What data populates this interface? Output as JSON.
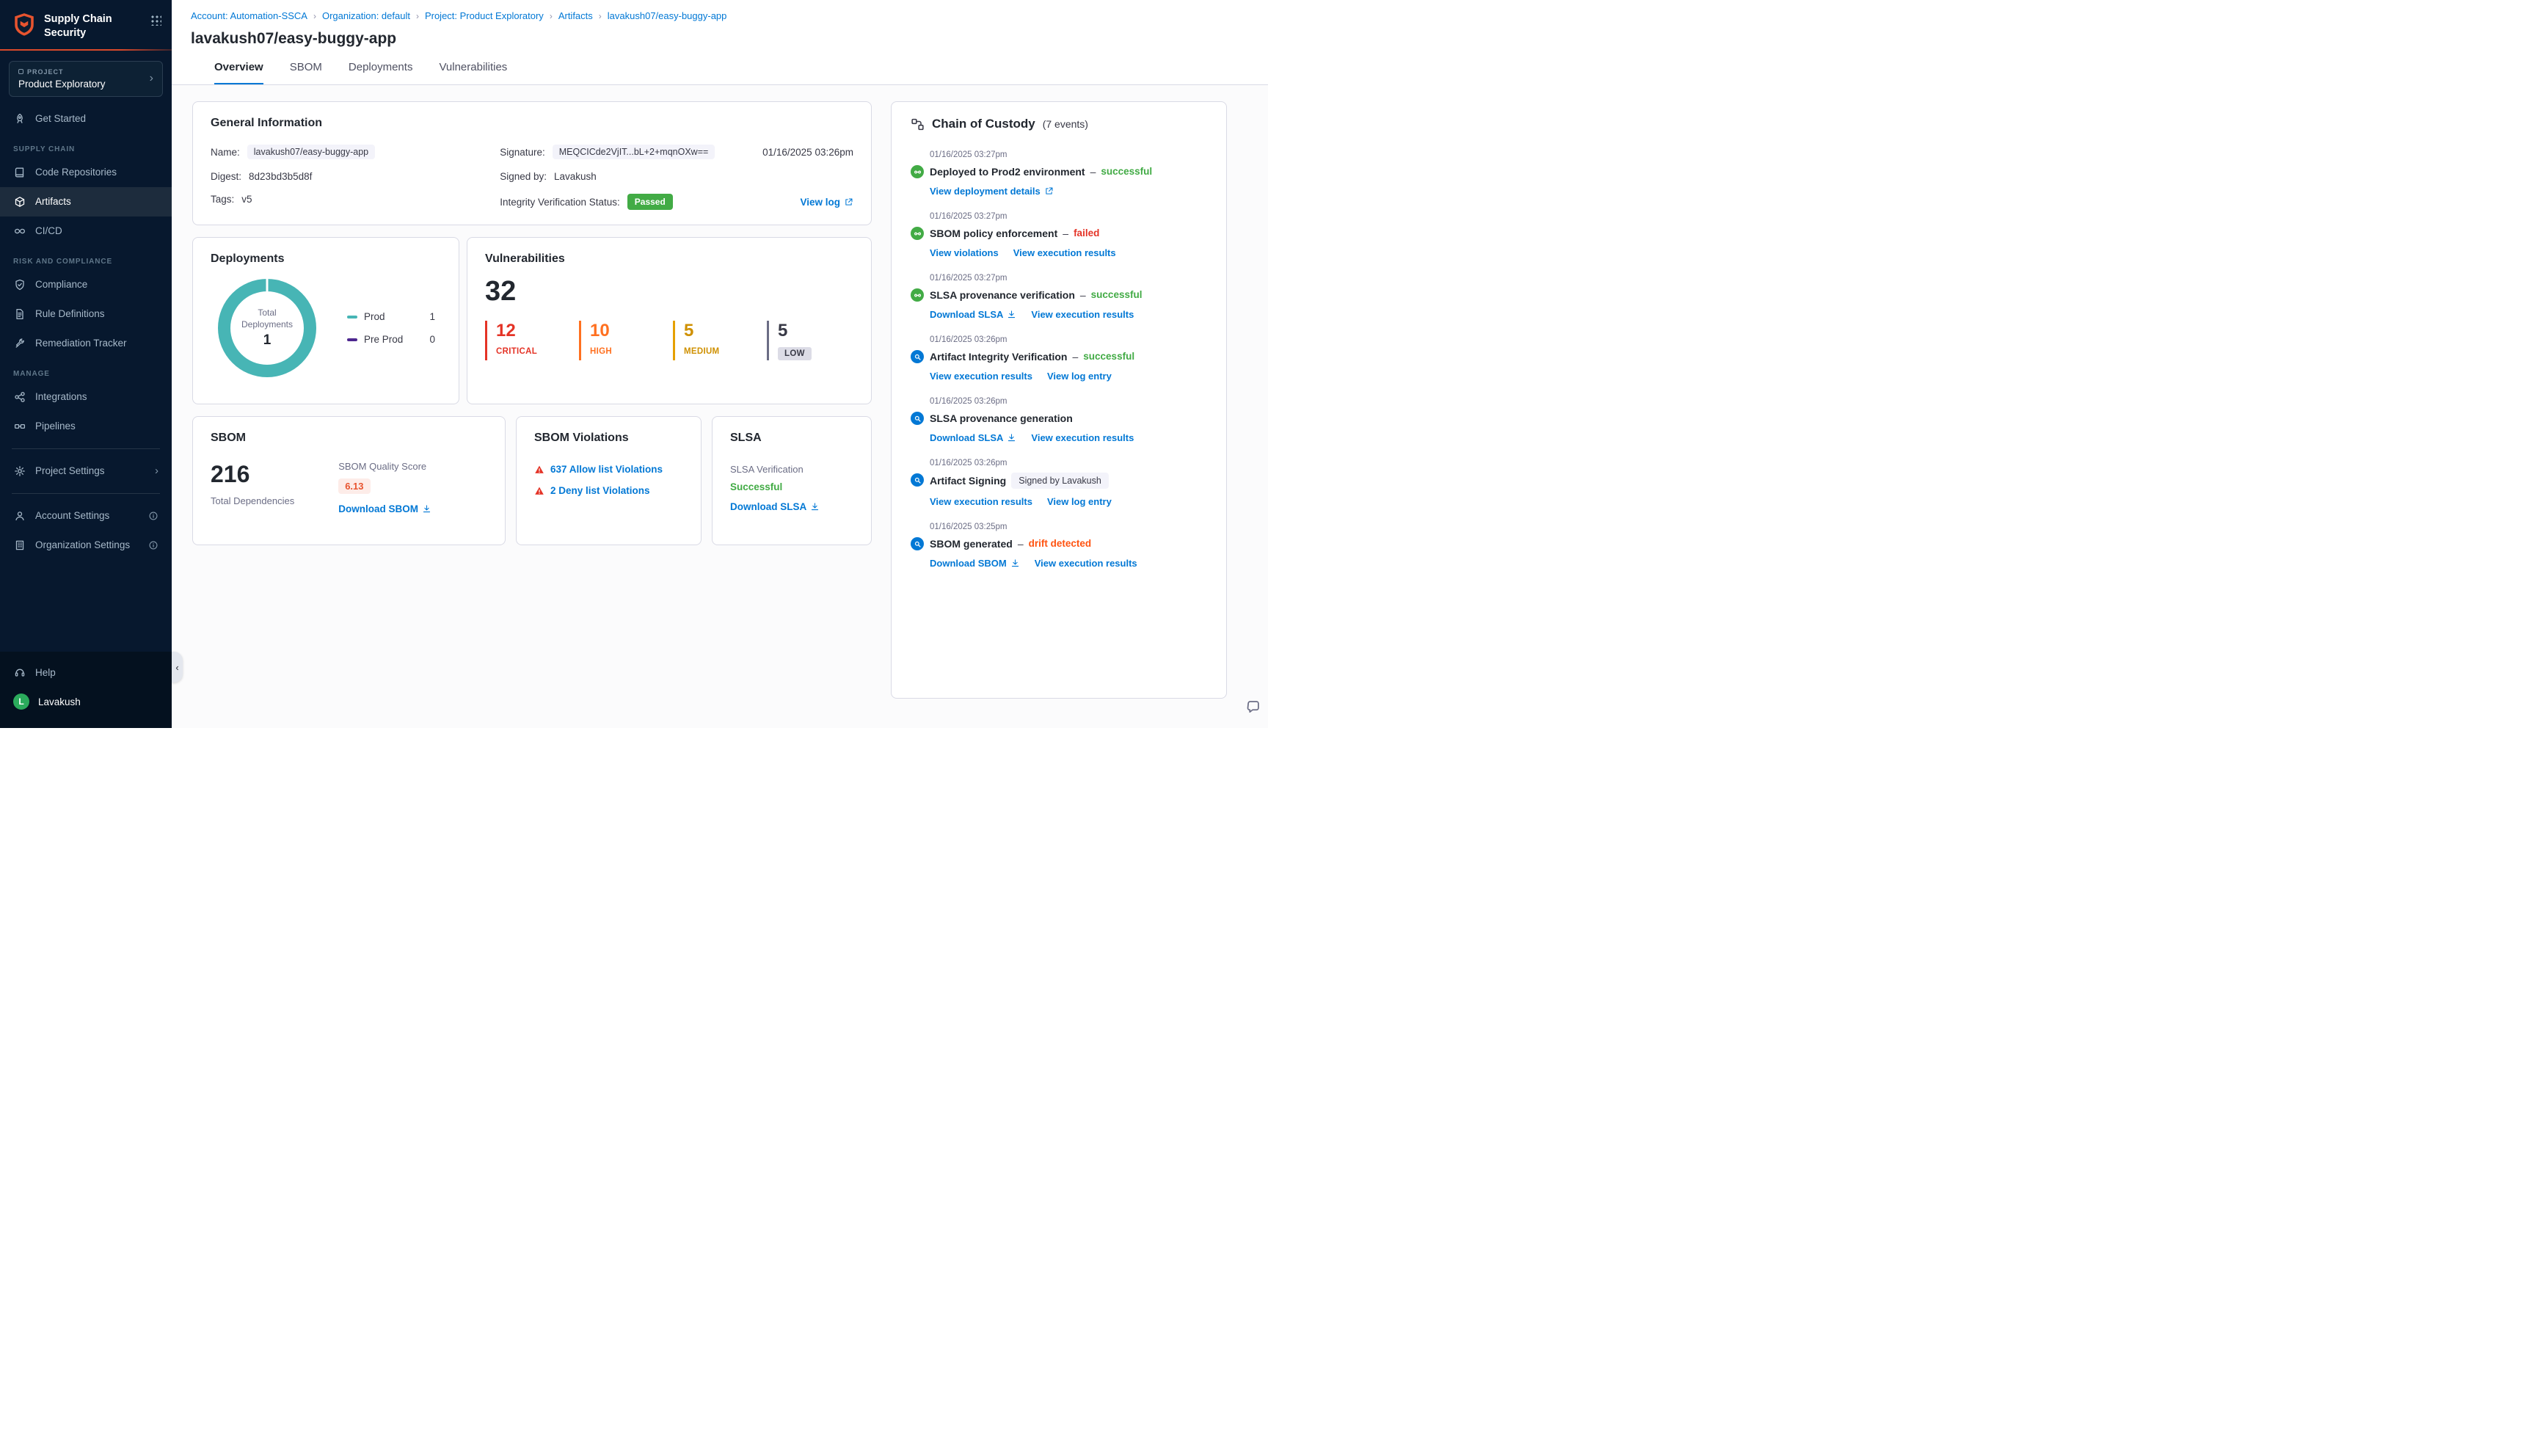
{
  "app": {
    "product_line1": "Supply Chain",
    "product_line2": "Security"
  },
  "icons": {
    "chevron_right": "›",
    "collapse_left": "‹",
    "breadcrumb_sep": "›"
  },
  "sidebar": {
    "project": {
      "eyebrow": "PROJECT",
      "name": "Product Exploratory"
    },
    "get_started": "Get Started",
    "section_supply_chain": "SUPPLY CHAIN",
    "section_risk": "RISK AND COMPLIANCE",
    "section_manage": "MANAGE",
    "code_repositories": "Code Repositories",
    "artifacts": "Artifacts",
    "cicd": "CI/CD",
    "compliance": "Compliance",
    "rule_definitions": "Rule Definitions",
    "remediation_tracker": "Remediation Tracker",
    "integrations": "Integrations",
    "pipelines": "Pipelines",
    "project_settings": "Project Settings",
    "account_settings": "Account Settings",
    "organization_settings": "Organization Settings",
    "help": "Help",
    "user_initial": "L",
    "user_name": "Lavakush"
  },
  "header": {
    "breadcrumb": [
      "Account: Automation-SSCA",
      "Organization: default",
      "Project: Product Exploratory",
      "Artifacts",
      "lavakush07/easy-buggy-app"
    ],
    "title": "lavakush07/easy-buggy-app",
    "tabs": [
      "Overview",
      "SBOM",
      "Deployments",
      "Vulnerabilities"
    ]
  },
  "general_info": {
    "title": "General Information",
    "name_label": "Name:",
    "name": "lavakush07/easy-buggy-app",
    "digest_label": "Digest:",
    "digest": "8d23bd3b5d8f",
    "tags_label": "Tags:",
    "tags": "v5",
    "signature_label": "Signature:",
    "signature": "MEQCICde2VjIT...bL+2+mqnOXw==",
    "signature_date": "01/16/2025 03:26pm",
    "signed_by_label": "Signed by:",
    "signed_by": "Lavakush",
    "integrity_label": "Integrity Verification Status:",
    "integrity_status": "Passed",
    "view_log": "View log"
  },
  "deployments": {
    "title": "Deployments",
    "center_line1": "Total",
    "center_line2": "Deployments",
    "total": "1",
    "legend": [
      {
        "label": "Prod",
        "value": "1",
        "color": "#47b5b5"
      },
      {
        "label": "Pre Prod",
        "value": "0",
        "color": "#4d278f"
      }
    ]
  },
  "vulnerabilities": {
    "title": "Vulnerabilities",
    "total": "32",
    "severities": [
      {
        "count": "12",
        "label": "CRITICAL",
        "color": "#e43326"
      },
      {
        "count": "10",
        "label": "HIGH",
        "color": "#ff7020"
      },
      {
        "count": "5",
        "label": "MEDIUM",
        "color": "#e5a000"
      },
      {
        "count": "5",
        "label": "LOW",
        "color": "#6b6d85"
      }
    ]
  },
  "sbom": {
    "title": "SBOM",
    "total": "216",
    "total_label": "Total Dependencies",
    "quality_label": "SBOM Quality Score",
    "quality_score": "6.13",
    "download": "Download SBOM"
  },
  "sbom_violations": {
    "title": "SBOM Violations",
    "allow": "637 Allow list Violations",
    "deny": "2 Deny list Violations"
  },
  "slsa": {
    "title": "SLSA",
    "verification_label": "SLSA Verification",
    "status": "Successful",
    "download": "Download SLSA"
  },
  "chain": {
    "title": "Chain of Custody",
    "events_count": "(7 events)",
    "dash": "–",
    "events": [
      {
        "time": "01/16/2025 03:27pm",
        "title": "Deployed to Prod2 environment",
        "status": "successful",
        "links": [
          "View deployment details"
        ]
      },
      {
        "time": "01/16/2025 03:27pm",
        "title": "SBOM policy enforcement",
        "status": "failed",
        "links": [
          "View violations",
          "View execution results"
        ]
      },
      {
        "time": "01/16/2025 03:27pm",
        "title": "SLSA provenance verification",
        "status": "successful",
        "links": [
          "Download SLSA",
          "View execution results"
        ]
      },
      {
        "time": "01/16/2025 03:26pm",
        "title": "Artifact Integrity Verification",
        "status": "successful",
        "links": [
          "View execution results",
          "View log entry"
        ]
      },
      {
        "time": "01/16/2025 03:26pm",
        "title": "SLSA provenance generation",
        "links": [
          "Download SLSA",
          "View execution results"
        ]
      },
      {
        "time": "01/16/2025 03:26pm",
        "title": "Artifact Signing",
        "badge": "Signed by Lavakush",
        "links": [
          "View execution results",
          "View log entry"
        ]
      },
      {
        "time": "01/16/2025 03:25pm",
        "title": "SBOM generated",
        "status": "drift detected",
        "links": [
          "Download SBOM",
          "View execution results"
        ]
      }
    ]
  },
  "colors": {
    "primary_blue": "#0278d5",
    "success_green": "#42ab45",
    "critical_red": "#e43326",
    "high_orange": "#ff7020",
    "medium_amber": "#e5a000",
    "teal": "#47b5b5",
    "pre_prod_purple": "#4d278f",
    "accent_orange": "#e8542f",
    "sidebar_bg": "#07182e"
  }
}
